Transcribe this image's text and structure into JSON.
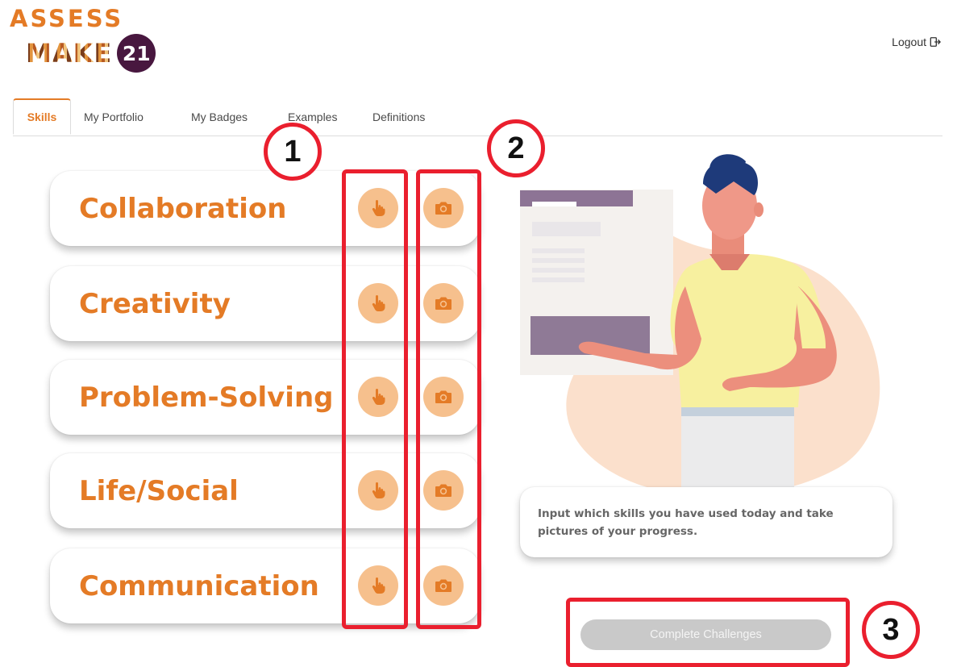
{
  "logo": {
    "top": "ASSESS",
    "word": "MAKE",
    "number": "21"
  },
  "header": {
    "logout_label": "Logout",
    "logout_icon": "logout-icon"
  },
  "tabs": [
    {
      "label": "Skills",
      "active": true
    },
    {
      "label": "My Portfolio",
      "active": false
    },
    {
      "label": "My Badges",
      "active": false
    },
    {
      "label": "Examples",
      "active": false
    },
    {
      "label": "Definitions",
      "active": false
    }
  ],
  "skills": [
    {
      "label": "Collaboration",
      "select_icon": "hand-pointer-icon",
      "photo_icon": "camera-icon"
    },
    {
      "label": "Creativity",
      "select_icon": "hand-pointer-icon",
      "photo_icon": "camera-icon"
    },
    {
      "label": "Problem-Solving",
      "select_icon": "hand-pointer-icon",
      "photo_icon": "camera-icon"
    },
    {
      "label": "Life/Social",
      "select_icon": "hand-pointer-icon",
      "photo_icon": "camera-icon"
    },
    {
      "label": "Communication",
      "select_icon": "hand-pointer-icon",
      "photo_icon": "camera-icon"
    }
  ],
  "info_text": "Input which skills you have used today and take pictures of your progress.",
  "complete_button": "Complete Challenges",
  "annotations": [
    "1",
    "2",
    "3"
  ],
  "colors": {
    "accent": "#e47b26",
    "button_fill": "#f6c08d",
    "highlight": "#ea1f2e",
    "logo_badge": "#48173f",
    "disabled_button": "#c9c9c9"
  }
}
